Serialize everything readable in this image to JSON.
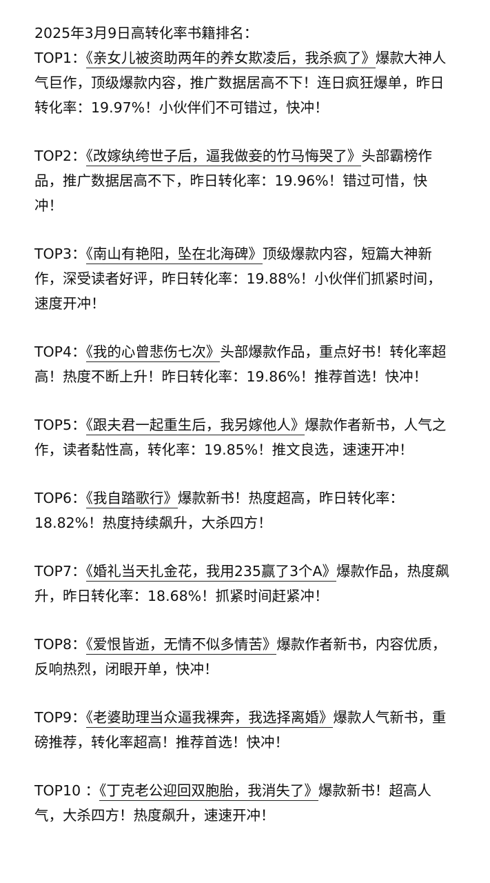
{
  "header": {
    "title": "2025年3月9日高转化率书籍排名："
  },
  "entries": [
    {
      "rank": "TOP1：",
      "book": "《亲女儿被资助两年的养女欺凌后，我杀疯了》",
      "desc": "爆款大神人气巨作，顶级爆款内容，推广数据居高不下！连日疯狂爆单，昨日转化率：19.97%！小伙伴们不可错过，快冲！"
    },
    {
      "rank": "TOP2：",
      "book": "《改嫁纨绔世子后，逼我做妾的竹马悔哭了》",
      "desc": "头部霸榜作品，推广数据居高不下，昨日转化率：19.96%！错过可惜，快冲！"
    },
    {
      "rank": "TOP3：",
      "book": "《南山有艳阳，坠在北海碑》",
      "desc": "顶级爆款内容，短篇大神新作，深受读者好评，昨日转化率：19.88%！小伙伴们抓紧时间，速度开冲！"
    },
    {
      "rank": "TOP4：",
      "book": "《我的心曾悲伤七次》",
      "desc": "头部爆款作品，重点好书！转化率超高！热度不断上升！昨日转化率：19.86%！推荐首选！快冲！"
    },
    {
      "rank": "TOP5：",
      "book": "《跟夫君一起重生后，我另嫁他人》",
      "desc": "爆款作者新书，人气之作，读者黏性高，转化率：19.85%！推文良选，速速开冲！"
    },
    {
      "rank": "TOP6：",
      "book": "《我自踏歌行》",
      "desc": "爆款新书！热度超高，昨日转化率：18.82%！热度持续飙升，大杀四方！"
    },
    {
      "rank": "TOP7：",
      "book": "《婚礼当天扎金花，我用235赢了3个A》",
      "desc": "爆款作品，热度飙升，昨日转化率：18.68%！抓紧时间赶紧冲！"
    },
    {
      "rank": "TOP8：",
      "book": "《爱恨皆逝，无情不似多情苦》",
      "desc": "爆款作者新书，内容优质，反响热烈，闭眼开单，快冲！"
    },
    {
      "rank": "TOP9：",
      "book": "《老婆助理当众逼我裸奔，我选择离婚》",
      "desc": "爆款人气新书，重磅推荐，转化率超高！推荐首选！快冲！"
    },
    {
      "rank": "TOP10 ：",
      "book": "《丁克老公迎回双胞胎，我消失了》",
      "desc": "爆款新书！超高人气，大杀四方！热度飙升，速速开冲！"
    }
  ]
}
